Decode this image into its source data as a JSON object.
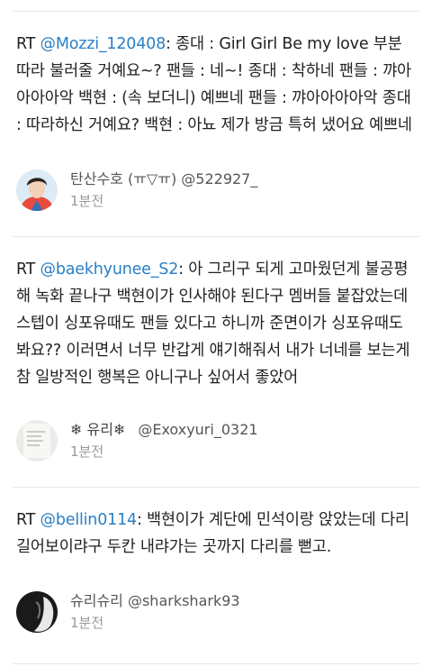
{
  "tweets": [
    {
      "prefix": "RT ",
      "mention": "@Mozzi_120408",
      "text": ": 종대 : Girl Girl Be my love 부분 따라 불러줄 거예요~? 팬들 : 네~! 종대 : 착하네 팬들 : 꺄아아아아악 백현 : (속 보더니) 예쁘네 팬들 : 꺄아아아아악 종대 : 따라하신 거예요? 백현 : 아뇨 제가 방금 특허 냈어요 예쁘네",
      "author_name": "탄산수호 (ㅠ▽ㅠ) @522927_",
      "time": "1분전"
    },
    {
      "prefix": "RT ",
      "mention": "@baekhyunee_S2",
      "text": ": 아 그리구 되게 고마웠던게 불공평해 녹화 끝나구 백현이가 인사해야 된다구 멤버들 붙잡았는데 스텝이 싱포유때도 팬들 있다고 하니까 준면이가 싱포유때도 봐요?? 이러면서 너무 반갑게 얘기해줘서 내가 너네를 보는게 참 일방적인 행복은 아니구나 싶어서 좋았어",
      "author_prefix": "❄ 유리❄",
      "author_handle": "@Exoxyuri_0321",
      "time": "1분전"
    },
    {
      "prefix": "RT ",
      "mention": "@bellin0114",
      "text": ": 백현이가 계단에 민석이랑 앉았는데 다리길어보이랴구 두칸 내랴가는 곳까지 다리를 뻗고.",
      "author_name": "슈리슈리 @sharkshark93",
      "time": "1분전"
    }
  ],
  "colors": {
    "mention": "#2a7fc7",
    "divider": "#e6e6e6",
    "meta": "#999999"
  },
  "icons": [
    "avatar-photo",
    "snowflake-icon"
  ]
}
